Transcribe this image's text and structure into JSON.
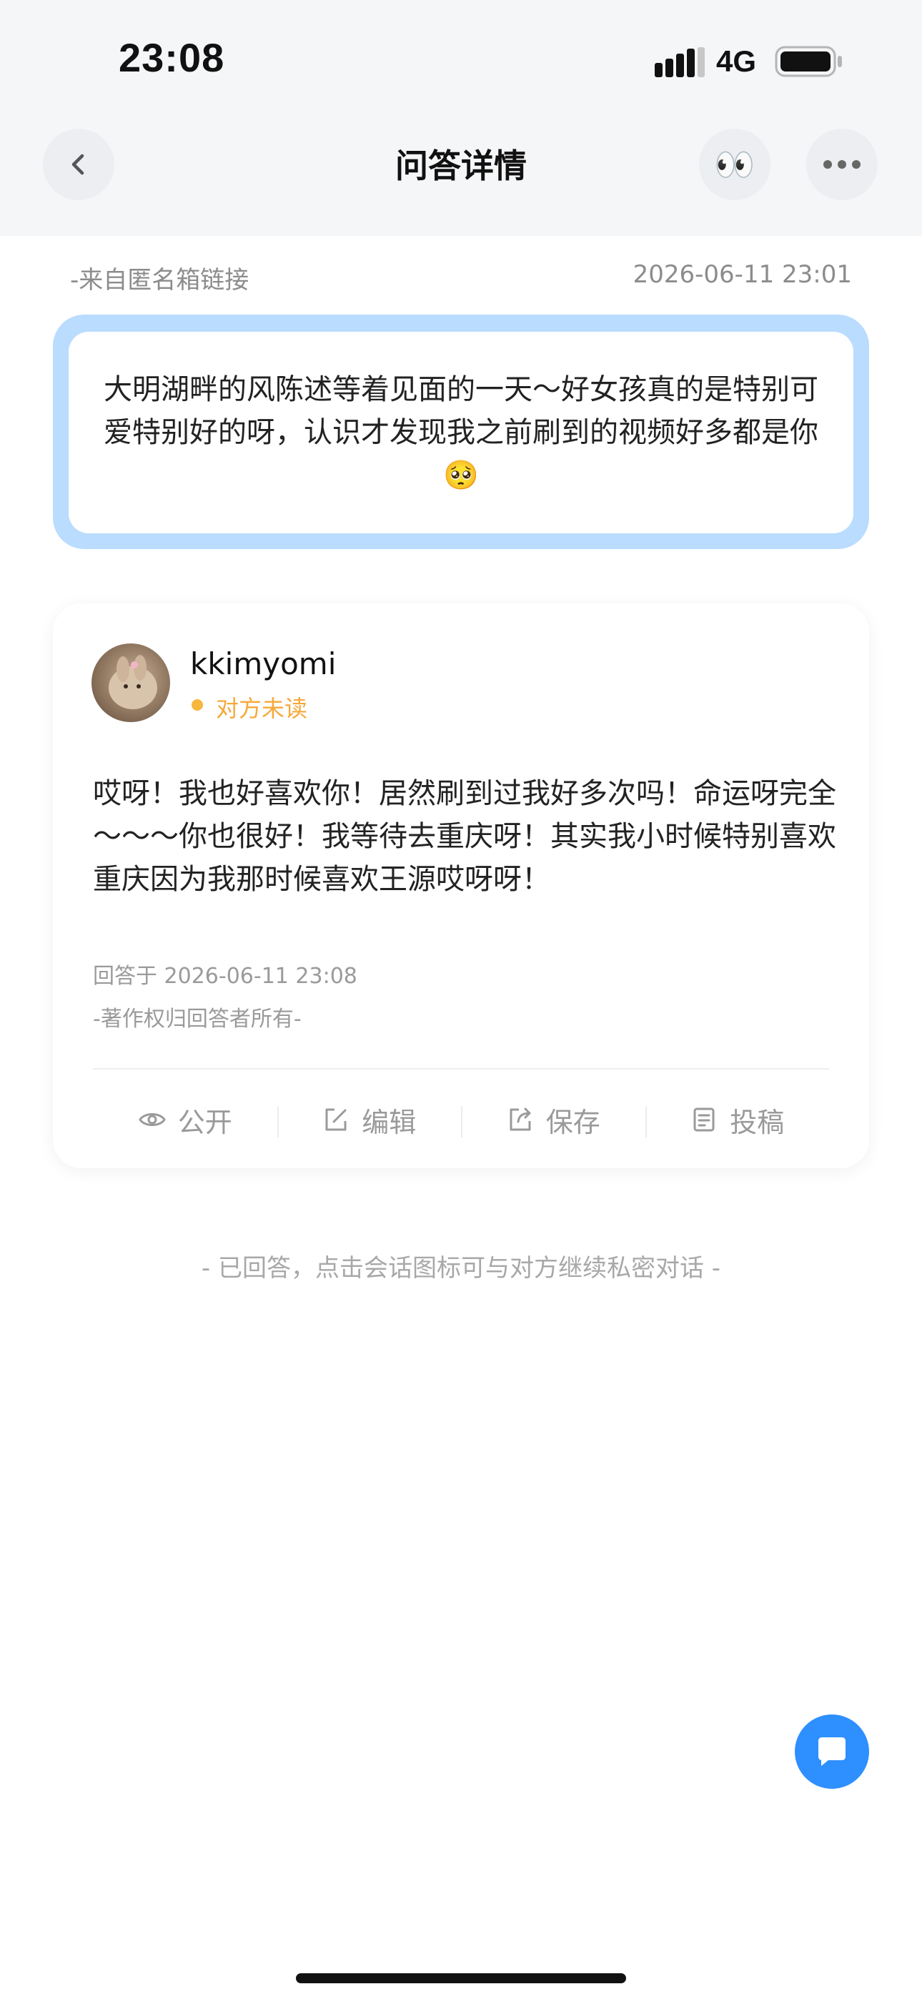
{
  "status_bar": {
    "time": "23:08",
    "network": "4G",
    "icons": [
      "signal-icon",
      "battery-icon"
    ]
  },
  "nav": {
    "title": "问答详情",
    "back_icon": "chevron-left-icon",
    "eyes_icon": "eyes-emoji-icon",
    "eyes_glyph": "👀",
    "more_icon": "more-dots-icon"
  },
  "question": {
    "source": "-来自匿名箱链接",
    "timestamp": "2026-06-11 23:01",
    "text": "大明湖畔的风陈述等着见面的一天～好女孩真的是特别可爱特别好的呀，认识才发现我之前刷到的视频好多都是你🥺"
  },
  "answer": {
    "username": "kkimyomi",
    "read_status": "对方未读",
    "text": "哎呀！我也好喜欢你！居然刷到过我好多次吗！命运呀完全～～～你也很好！我等待去重庆呀！其实我小时候特别喜欢重庆因为我那时候喜欢王源哎呀呀！",
    "answered_at": "回答于 2026-06-11 23:08",
    "copyright": "-著作权归回答者所有-",
    "actions": [
      {
        "label": "公开",
        "icon": "eye-icon"
      },
      {
        "label": "编辑",
        "icon": "edit-icon"
      },
      {
        "label": "保存",
        "icon": "export-icon"
      },
      {
        "label": "投稿",
        "icon": "document-icon"
      }
    ]
  },
  "footer_note": "- 已回答，点击会话图标可与对方继续私密对话 -",
  "colors": {
    "accent_blue": "#2e8fff",
    "question_border": "#b9dcff",
    "unread_orange": "#f6a83a",
    "header_bg": "#f5f6f8"
  }
}
